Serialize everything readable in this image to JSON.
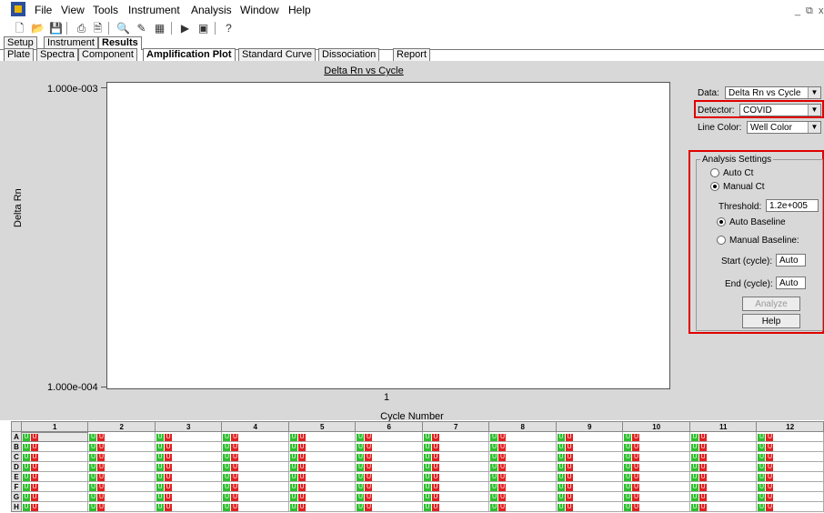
{
  "menu": {
    "items": [
      "File",
      "View",
      "Tools",
      "Instrument",
      "Analysis",
      "Window",
      "Help"
    ]
  },
  "window_controls": {
    "minimize": "_",
    "restore": "⧉",
    "close": "x"
  },
  "tabs_top": [
    "Setup",
    "Instrument",
    "Results"
  ],
  "tabs_sub": [
    "Plate",
    "Spectra",
    "Component",
    "Amplification Plot",
    "Standard Curve",
    "Dissociation",
    "Report"
  ],
  "chart": {
    "title": "Delta Rn vs Cycle",
    "y_top": "1.000e-003",
    "y_bottom": "1.000e-004",
    "x_tick": "1",
    "ylabel": "Delta Rn",
    "xlabel": "Cycle Number"
  },
  "chart_data": {
    "type": "line",
    "title": "Delta Rn vs Cycle",
    "xlabel": "Cycle Number",
    "ylabel": "Delta Rn",
    "x_ticks": [
      "1"
    ],
    "y_ticks": [
      "1.000e-004",
      "1.000e-003"
    ],
    "ylim": [
      0.0001,
      0.001
    ],
    "y_scale": "log",
    "series": []
  },
  "panel": {
    "data_label": "Data:",
    "data_value": "Delta Rn vs Cycle",
    "detector_label": "Detector:",
    "detector_value": "COVID",
    "line_color_label": "Line Color:",
    "line_color_value": "Well Color"
  },
  "analysis": {
    "title": "Analysis Settings",
    "auto_ct": "Auto Ct",
    "manual_ct": "Manual Ct",
    "threshold_label": "Threshold:",
    "threshold_value": "1.2e+005",
    "auto_baseline": "Auto Baseline",
    "manual_baseline": "Manual Baseline:",
    "start_label": "Start (cycle):",
    "start_value": "Auto",
    "end_label": "End (cycle):",
    "end_value": "Auto",
    "analyze_button": "Analyze",
    "help_button": "Help"
  },
  "plate": {
    "columns": [
      "1",
      "2",
      "3",
      "4",
      "5",
      "6",
      "7",
      "8",
      "9",
      "10",
      "11",
      "12"
    ],
    "rows": [
      "A",
      "B",
      "C",
      "D",
      "E",
      "F",
      "G",
      "H"
    ],
    "well_label": "U"
  },
  "colors": {
    "highlight": "#e00000",
    "well_green": "#2cbf2c",
    "well_red": "#e02020",
    "background": "#d8d8d8"
  }
}
